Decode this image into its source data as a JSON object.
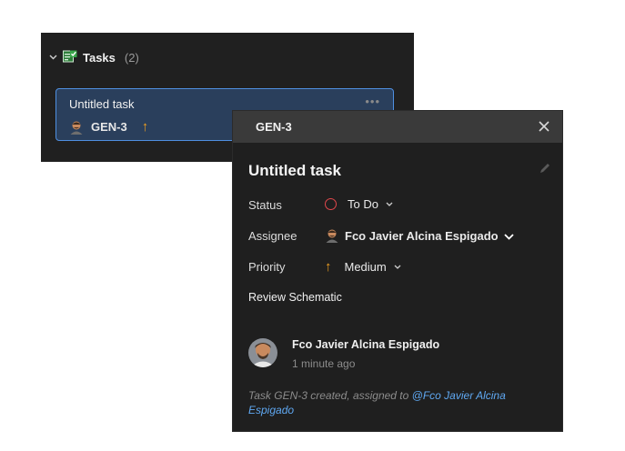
{
  "tasks_panel": {
    "title": "Tasks",
    "count": "(2)",
    "card": {
      "title": "Untitled task",
      "more": "•••",
      "id": "GEN-3",
      "priority_icon": "arrow-up-icon"
    }
  },
  "detail": {
    "id": "GEN-3",
    "title": "Untitled task",
    "props": {
      "status_label": "Status",
      "status_value": "To Do",
      "assignee_label": "Assignee",
      "assignee_value": "Fco Javier Alcina Espigado",
      "priority_label": "Priority",
      "priority_value": "Medium"
    },
    "link": "Review Schematic",
    "comment": {
      "author": "Fco Javier Alcina Espigado",
      "time": "1 minute ago"
    },
    "activity": {
      "text": "Task GEN-3 created, assigned to ",
      "mention": "@Fco Javier Alcina Espigado"
    }
  },
  "colors": {
    "accent_blue": "#4f8fe0",
    "priority_orange": "#f0a020",
    "status_red": "#e0474c",
    "mention_blue": "#5fa8f2"
  }
}
